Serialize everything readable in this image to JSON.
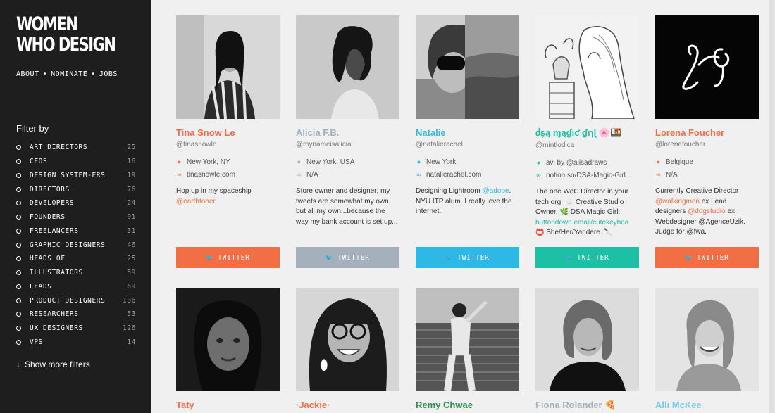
{
  "brand": {
    "logo_line1": "WOMEN",
    "logo_line2": "WHO DESIGN"
  },
  "nav": [
    {
      "label": "ABOUT"
    },
    {
      "label": "NOMINATE"
    },
    {
      "label": "JOBS"
    }
  ],
  "nav_separator": "•",
  "filter_title": "Filter by",
  "filters": [
    {
      "label": "ART DIRECTORS",
      "count": "25"
    },
    {
      "label": "CEOS",
      "count": "16"
    },
    {
      "label": "DESIGN SYSTEM-ERS",
      "count": "19"
    },
    {
      "label": "DIRECTORS",
      "count": "76"
    },
    {
      "label": "DEVELOPERS",
      "count": "24"
    },
    {
      "label": "FOUNDERS",
      "count": "91"
    },
    {
      "label": "FREELANCERS",
      "count": "31"
    },
    {
      "label": "GRAPHIC DESIGNERS",
      "count": "46"
    },
    {
      "label": "HEADS OF",
      "count": "25"
    },
    {
      "label": "ILLUSTRATORS",
      "count": "59"
    },
    {
      "label": "LEADS",
      "count": "69"
    },
    {
      "label": "PRODUCT DESIGNERS",
      "count": "136"
    },
    {
      "label": "RESEARCHERS",
      "count": "53"
    },
    {
      "label": "UX DESIGNERS",
      "count": "126"
    },
    {
      "label": "VPS",
      "count": "14"
    }
  ],
  "show_more": "Show more filters",
  "twitter_label": "TWITTER",
  "cards": [
    {
      "name": "Tina Snow Le",
      "handle": "@tinasnowle",
      "location": "New York, NY",
      "link": "tinasnowle.com",
      "bio1": "Hop up in my spaceship ",
      "bio_link1": "@earthtoher",
      "bio2": "",
      "bio_link2": "",
      "bio3": "",
      "accent": "#f26f46"
    },
    {
      "name": "Alicia F.B.",
      "handle": "@mynameisalicia",
      "location": "New York, USA",
      "link": "N/A",
      "bio1": "Store owner and designer; my tweets are somewhat my own, but all my own...because the way my bank account is set up...",
      "bio_link1": "",
      "bio2": "",
      "bio_link2": "",
      "bio3": "",
      "accent": "#a4b0bb"
    },
    {
      "name": "Natalie",
      "handle": "@natalierachel",
      "location": "New York",
      "link": "natalierachel.com",
      "bio1": "Designing Lightroom ",
      "bio_link1": "@adobe",
      "bio2": ". NYU ITP alum. I really love the internet.",
      "bio_link2": "",
      "bio3": "",
      "accent": "#2eb8e6"
    },
    {
      "name": "ძşą ɱąɠıƈ ɠıɿɭ 🌸🍱",
      "handle": "@mintlodica",
      "location": "avi by @alisadraws",
      "link": "notion.so/DSA-Magic-Girl...",
      "bio1": "The one WoC Director in your tech org. ☁️ Creative Studio Owner. 🌿 DSA Magic Girl: ",
      "bio_link1": "buttondown.email/cutekeyboa",
      "bio2": " 📛 She/Her/Yandere. 🔪",
      "bio_link2": "",
      "bio3": "",
      "accent": "#1dc0a4"
    },
    {
      "name": "Lorena Foucher",
      "handle": "@lorenafoucher",
      "location": "Belgique",
      "link": "N/A",
      "bio1": "Currently Creative Director ",
      "bio_link1": "@walkingmen",
      "bio2": " ex Lead designers ",
      "bio_link2": "@dogstudio",
      "bio3": " ex Webdesigner @AgenceUzik. Judge for @fwa.",
      "accent": "#f26f46"
    },
    {
      "name": "Taty",
      "accent": "#f26f46"
    },
    {
      "name": "·Jackie·",
      "accent": "#f26f46"
    },
    {
      "name": "Remy Chwae",
      "accent": "#2f8f4e"
    },
    {
      "name": "Fiona Rolander 🍕",
      "accent": "#a4b0bb"
    },
    {
      "name": "Alli McKee",
      "accent": "#7cc8ea"
    }
  ],
  "colors": {
    "sidebar_bg": "#1e1e1e",
    "page_bg": "#f0f0f0",
    "orange": "#f26f46",
    "grey": "#a4b0bb",
    "blue": "#2eb8e6",
    "teal": "#1dc0a4"
  },
  "icons": {
    "location": "location-pin-icon",
    "link": "link-icon",
    "twitter": "twitter-bird-icon",
    "arrow": "arrow-down-icon"
  }
}
